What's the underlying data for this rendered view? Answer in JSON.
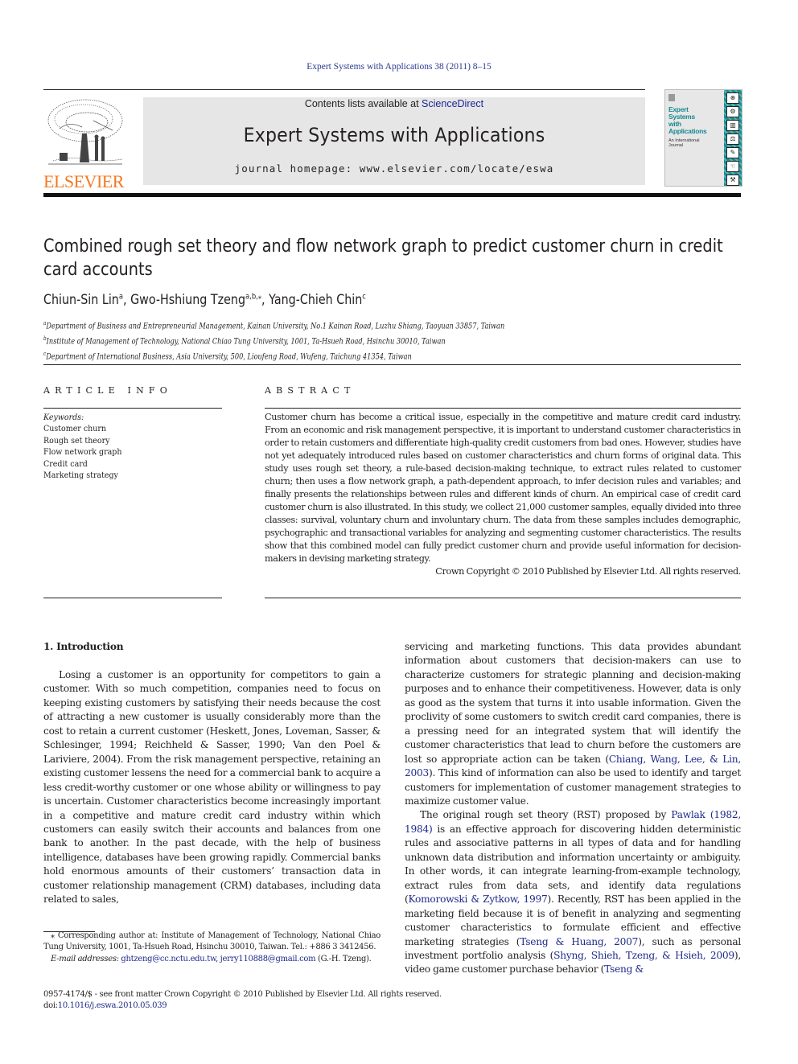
{
  "header": {
    "journal_ref": "Expert Systems with Applications 38 (2011) 8–15",
    "publisher_logo_text": "ELSEVIER",
    "contents_prefix": "Contents lists available at ",
    "contents_link": "ScienceDirect",
    "journal_title": "Expert Systems with Applications",
    "homepage_prefix": "journal homepage: ",
    "homepage_url": "www.elsevier.com/locate/eswa",
    "cover": {
      "title_lines": [
        "Expert",
        "Systems",
        "with",
        "Applications"
      ],
      "subtitle_lines": [
        "An International",
        "Journal"
      ]
    }
  },
  "article": {
    "title": "Combined rough set theory and flow network graph to predict customer churn in credit card accounts",
    "authors": [
      {
        "name": "Chiun-Sin Lin",
        "sup": "a"
      },
      {
        "name": "Gwo-Hshiung Tzeng",
        "sup": "a,b,⁎"
      },
      {
        "name": "Yang-Chieh Chin",
        "sup": "c"
      }
    ],
    "affiliations": [
      {
        "sup": "a",
        "text": "Department of Business and Entrepreneurial Management, Kainan University, No.1 Kainan Road, Luzhu Shiang, Taoyuan 33857, Taiwan"
      },
      {
        "sup": "b",
        "text": "Institute of Management of Technology, National Chiao Tung University, 1001, Ta-Hsueh Road, Hsinchu 30010, Taiwan"
      },
      {
        "sup": "c",
        "text": "Department of International Business, Asia University, 500, Lioufeng Road, Wufeng, Taichung 41354, Taiwan"
      }
    ]
  },
  "article_info": {
    "heading": "ARTICLE INFO",
    "keywords_label": "Keywords:",
    "keywords": [
      "Customer churn",
      "Rough set theory",
      "Flow network graph",
      "Credit card",
      "Marketing strategy"
    ]
  },
  "abstract": {
    "heading": "ABSTRACT",
    "text": "Customer churn has become a critical issue, especially in the competitive and mature credit card industry. From an economic and risk management perspective, it is important to understand customer characteristics in order to retain customers and differentiate high-quality credit customers from bad ones. However, studies have not yet adequately introduced rules based on customer characteristics and churn forms of original data. This study uses rough set theory, a rule-based decision-making technique, to extract rules related to customer churn; then uses a flow network graph, a path-dependent approach, to infer decision rules and variables; and finally presents the relationships between rules and different kinds of churn. An empirical case of credit card customer churn is also illustrated. In this study, we collect 21,000 customer samples, equally divided into three classes: survival, voluntary churn and involuntary churn. The data from these samples includes demographic, psychographic and transactional variables for analyzing and segmenting customer characteristics. The results show that this combined model can fully predict customer churn and provide useful information for decision-makers in devising marketing strategy.",
    "copyright": "Crown Copyright © 2010 Published by Elsevier Ltd. All rights reserved."
  },
  "body": {
    "section_heading": "1. Introduction",
    "left_p1": {
      "t1": "Losing a customer is an opportunity for competitors to gain a customer. With so much competition, companies need to focus on keeping existing customers by satisfying their needs because the cost of attracting a new customer is usually considerably more than the cost to retain a current customer (Heskett, Jones, Loveman, Sasser, & Schlesinger, 1994; Reichheld & Sasser, 1990; Van den Poel & Lariviere, 2004). From the risk management perspective, retaining an existing customer lessens the need for a commercial bank to acquire a less credit-worthy customer or one whose ability or willingness to pay is uncertain. Customer characteristics become increasingly important in a competitive and mature credit card industry within which customers can easily switch their accounts and balances from one bank to another. In the past decade, with the help of business intelligence, databases have been growing rapidly. Commercial banks hold enormous amounts of their customers’ transaction data in customer relationship management (CRM) databases, including data related to sales,"
    },
    "right_p1": {
      "t1": "servicing and marketing functions. This data provides abundant information about customers that decision-makers can use to characterize customers for strategic planning and decision-making purposes and to enhance their competitiveness. However, data is only as good as the system that turns it into usable information. Given the proclivity of some customers to switch credit card companies, there is a pressing need for an integrated system that will identify the customer characteristics that lead to churn before the customers are lost so appropriate action can be taken (",
      "cite1": "Chiang, Wang, Lee, & Lin, 2003",
      "t2": "). This kind of information can also be used to identify and target customers for implementation of customer management strategies to maximize customer value."
    },
    "right_p2": {
      "t1": "The original rough set theory (RST) proposed by ",
      "cite1": "Pawlak (1982, 1984)",
      "t2": " is an effective approach for discovering hidden deterministic rules and associative patterns in all types of data and for handling unknown data distribution and information uncertainty or ambiguity. In other words, it can integrate learning-from-example technology, extract rules from data sets, and identify data regulations (",
      "cite2": "Komorowski & Zytkow, 1997",
      "t3": "). Recently, RST has been applied in the marketing field because it is of benefit in analyzing and segmenting customer characteristics to formulate efficient and effective marketing strategies (",
      "cite3": "Tseng & Huang, 2007",
      "t4": "), such as personal investment portfolio analysis (",
      "cite4": "Shyng, Shieh, Tzeng, & Hsieh, 2009",
      "t5": "), video game customer purchase behavior (",
      "cite5": "Tseng &"
    }
  },
  "footnote": {
    "corresponding": "⁎ Corresponding author at: Institute of Management of Technology, National Chiao Tung University, 1001, Ta-Hsueh Road, Hsinchu 30010, Taiwan. Tel.: +886 3 3412456.",
    "email_label": "E-mail addresses:",
    "email1": "ghtzeng@cc.nctu.edu.tw",
    "sep": ", ",
    "email2": "jerry110888@gmail.com",
    "email_suffix": " (G.-H. Tzeng)."
  },
  "front_matter": {
    "issn_line": "0957-4174/$ - see front matter Crown Copyright © 2010 Published by Elsevier Ltd. All rights reserved.",
    "doi_label": "doi:",
    "doi": "10.1016/j.eswa.2010.05.039"
  },
  "colors": {
    "link": "#1e2a8a",
    "elsevier_orange": "#f47920",
    "banner_bg": "#e6e6e6",
    "cover_teal": "#1f8c8f"
  }
}
